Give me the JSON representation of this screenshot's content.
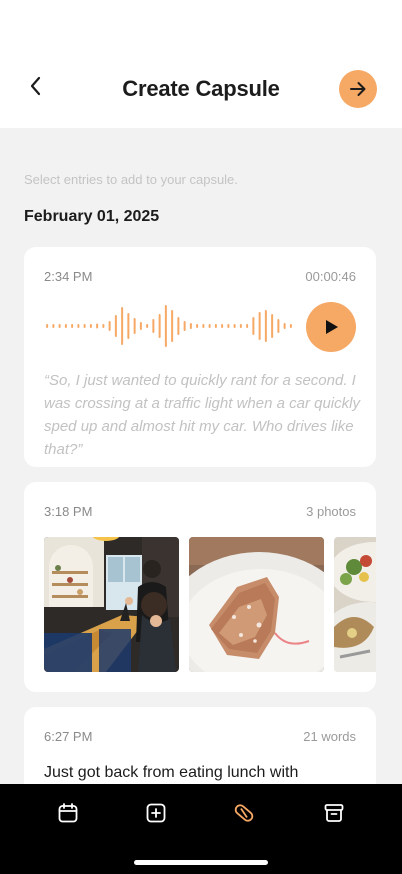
{
  "header": {
    "title": "Create Capsule"
  },
  "hint": "Select entries to add to your capsule.",
  "date": "February 01, 2025",
  "entries": [
    {
      "time": "2:34 PM",
      "meta": "00:00:46",
      "quote": "“So, I just wanted to quickly rant for a second. I was crossing at a traffic light when a car quickly sped up and almost hit my car. Who drives like that?”"
    },
    {
      "time": "3:18 PM",
      "meta": "3 photos"
    },
    {
      "time": "6:27 PM",
      "meta": "21 words",
      "text": "Just got back from eating lunch with"
    }
  ],
  "colors": {
    "accent": "#F6A865",
    "background": "#F2F2F2",
    "tabbar": "#000000"
  },
  "icons": {
    "back": "chevron-left-icon",
    "next": "arrow-right-icon",
    "play": "play-icon",
    "tabs": [
      "calendar-icon",
      "plus-square-icon",
      "capsule-icon",
      "archive-icon"
    ]
  }
}
